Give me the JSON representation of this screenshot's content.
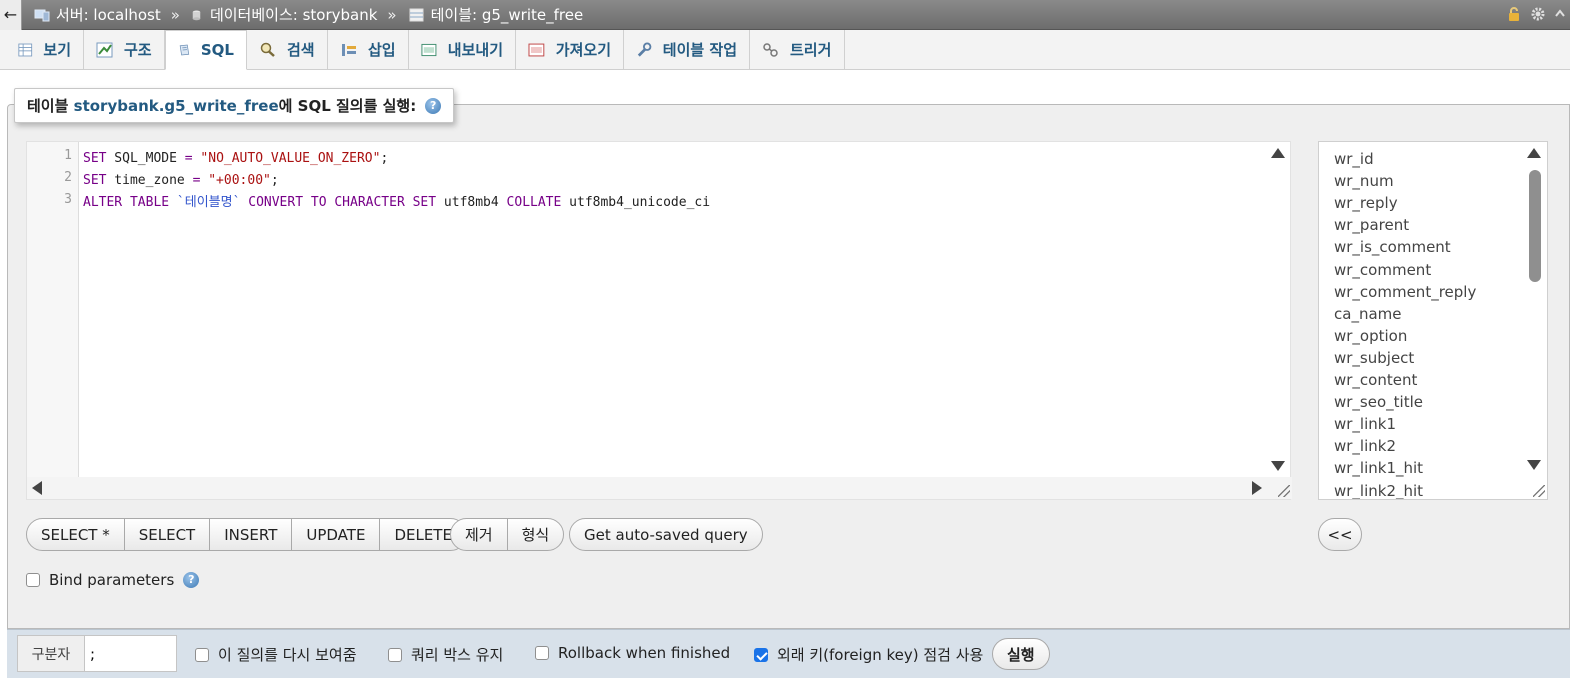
{
  "breadcrumb": {
    "back_glyph": "←",
    "server": "서버: localhost",
    "database": "데이터베이스: storybank",
    "table": "테이블: g5_write_free",
    "separator": "»"
  },
  "tabs": [
    {
      "label": "보기",
      "icon": "browse-icon"
    },
    {
      "label": "구조",
      "icon": "structure-icon"
    },
    {
      "label": "SQL",
      "icon": "sql-icon",
      "active": true
    },
    {
      "label": "검색",
      "icon": "search-icon"
    },
    {
      "label": "삽입",
      "icon": "insert-icon"
    },
    {
      "label": "내보내기",
      "icon": "export-icon"
    },
    {
      "label": "가져오기",
      "icon": "import-icon"
    },
    {
      "label": "테이블 작업",
      "icon": "operations-icon"
    },
    {
      "label": "트리거",
      "icon": "triggers-icon"
    }
  ],
  "legend": {
    "prefix": "테이블 ",
    "table_name": "storybank.g5_write_free",
    "suffix": "에 SQL 질의를 실행:",
    "help_glyph": "?"
  },
  "editor": {
    "line_numbers": [
      "1",
      "2",
      "3"
    ],
    "lines": [
      [
        {
          "t": "SET",
          "c": "kw"
        },
        {
          "t": " SQL_MODE ",
          "c": "plain"
        },
        {
          "t": "=",
          "c": "kw"
        },
        {
          "t": " ",
          "c": "plain"
        },
        {
          "t": "\"NO_AUTO_VALUE_ON_ZERO\"",
          "c": "str"
        },
        {
          "t": ";",
          "c": "plain"
        }
      ],
      [
        {
          "t": "SET",
          "c": "kw"
        },
        {
          "t": " time_zone ",
          "c": "plain"
        },
        {
          "t": "=",
          "c": "kw"
        },
        {
          "t": " ",
          "c": "plain"
        },
        {
          "t": "\"+00:00\"",
          "c": "str"
        },
        {
          "t": ";",
          "c": "plain"
        }
      ],
      [
        {
          "t": "ALTER TABLE",
          "c": "kw"
        },
        {
          "t": " ",
          "c": "plain"
        },
        {
          "t": "`테이블명`",
          "c": "str2"
        },
        {
          "t": " ",
          "c": "plain"
        },
        {
          "t": "CONVERT TO CHARACTER SET",
          "c": "kw"
        },
        {
          "t": " utf8mb4 ",
          "c": "plain"
        },
        {
          "t": "COLLATE",
          "c": "kw"
        },
        {
          "t": " utf8mb4_unicode_ci",
          "c": "plain"
        }
      ]
    ]
  },
  "columns": [
    "wr_id",
    "wr_num",
    "wr_reply",
    "wr_parent",
    "wr_is_comment",
    "wr_comment",
    "wr_comment_reply",
    "ca_name",
    "wr_option",
    "wr_subject",
    "wr_content",
    "wr_seo_title",
    "wr_link1",
    "wr_link2",
    "wr_link1_hit",
    "wr_link2_hit"
  ],
  "query_buttons": [
    "SELECT *",
    "SELECT",
    "INSERT",
    "UPDATE",
    "DELETE"
  ],
  "edit_buttons": [
    "제거",
    "형식"
  ],
  "autosave_button": "Get auto-saved query",
  "insert_column_button": "<<",
  "bind_parameters": {
    "label": "Bind parameters",
    "checked": false,
    "help_glyph": "?"
  },
  "bottom": {
    "delimiter_label": "구분자",
    "delimiter_value": ";",
    "show_query_again": {
      "label": "이 질의를 다시 보여줌",
      "checked": false
    },
    "retain_query_box": {
      "label": "쿼리 박스 유지",
      "checked": false
    },
    "rollback": {
      "label": "Rollback when finished",
      "checked": false
    },
    "foreign_key_checks": {
      "label": "외래 키(foreign key) 점검 사용",
      "checked": true
    },
    "go_button": "실행"
  },
  "colors": {
    "link": "#235a81",
    "keyword": "#770088",
    "string": "#aa1111",
    "identifier": "#3355cc",
    "checkbox_on": "#1a73e8"
  }
}
